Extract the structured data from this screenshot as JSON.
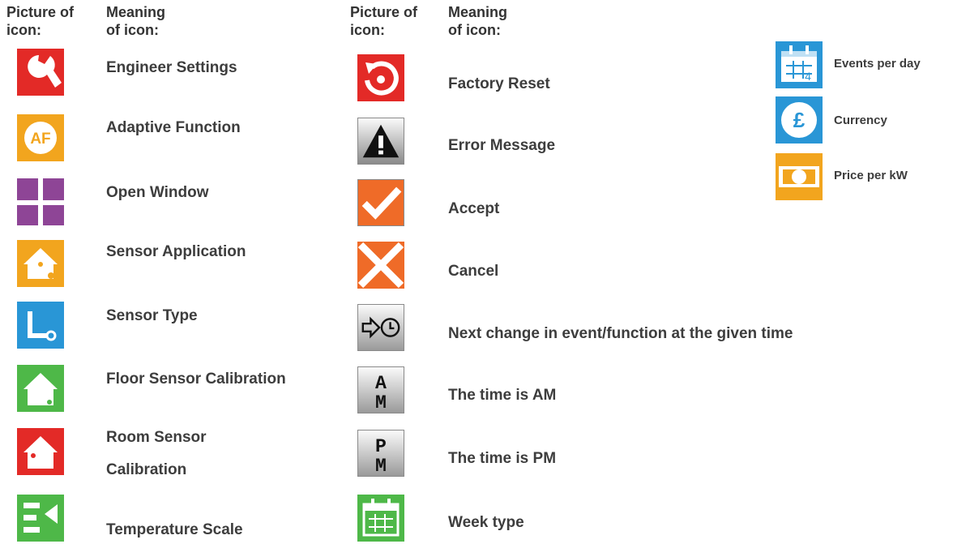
{
  "headers": {
    "left_picture": "Picture of\nicon:",
    "left_meaning": "Meaning\nof icon:",
    "mid_picture": "Picture of\nicon:",
    "mid_meaning": "Meaning\nof icon:"
  },
  "left_column": [
    {
      "label": "Engineer Settings",
      "icon": "wrench-icon",
      "color": "#e32a27"
    },
    {
      "label": "Adaptive Function",
      "icon": "af-icon",
      "icon_text": "AF",
      "color": "#f2a51e"
    },
    {
      "label": "Open Window",
      "icon": "window-icon",
      "color": "#8e4596"
    },
    {
      "label": "Sensor Application",
      "icon": "house-sensor-icon",
      "color": "#f2a51e"
    },
    {
      "label": "Sensor Type",
      "icon": "sensor-type-icon",
      "color": "#2996d6"
    },
    {
      "label": "Floor Sensor Calibration",
      "icon": "floor-sensor-house-icon",
      "color": "#4eb848"
    },
    {
      "label": "Room Sensor Calibration",
      "icon": "room-sensor-house-icon",
      "color": "#e32a27"
    },
    {
      "label": "Temperature Scale",
      "icon": "temperature-scale-icon",
      "color": "#4eb848"
    }
  ],
  "middle_column": [
    {
      "label": "Factory Reset",
      "icon": "reset-icon",
      "color": "#e32a27"
    },
    {
      "label": "Error Message",
      "icon": "warning-icon",
      "color": "#1a1a1a"
    },
    {
      "label": "Accept",
      "icon": "checkmark-icon",
      "color": "#ef6b28"
    },
    {
      "label": "Cancel",
      "icon": "cross-icon",
      "color": "#ef6b28"
    },
    {
      "label": "Next change in event/function at the given time",
      "icon": "arrow-clock-icon",
      "color": "#1a1a1a"
    },
    {
      "label": "The time is AM",
      "icon": "am-icon",
      "icon_text_top": "A",
      "icon_text_bottom": "M",
      "color": "#1a1a1a"
    },
    {
      "label": "The time is PM",
      "icon": "pm-icon",
      "icon_text_top": "P",
      "icon_text_bottom": "M",
      "color": "#1a1a1a"
    },
    {
      "label": "Week type",
      "icon": "week-calendar-icon",
      "color": "#4eb848"
    }
  ],
  "right_column": [
    {
      "label": "Events per day",
      "icon": "calendar-events-icon",
      "icon_text": "4",
      "color": "#2996d6"
    },
    {
      "label": "Currency",
      "icon": "currency-pound-icon",
      "icon_text": "£",
      "color": "#2996d6"
    },
    {
      "label": "Price per kW",
      "icon": "banknote-icon",
      "color": "#f2a51e"
    }
  ]
}
